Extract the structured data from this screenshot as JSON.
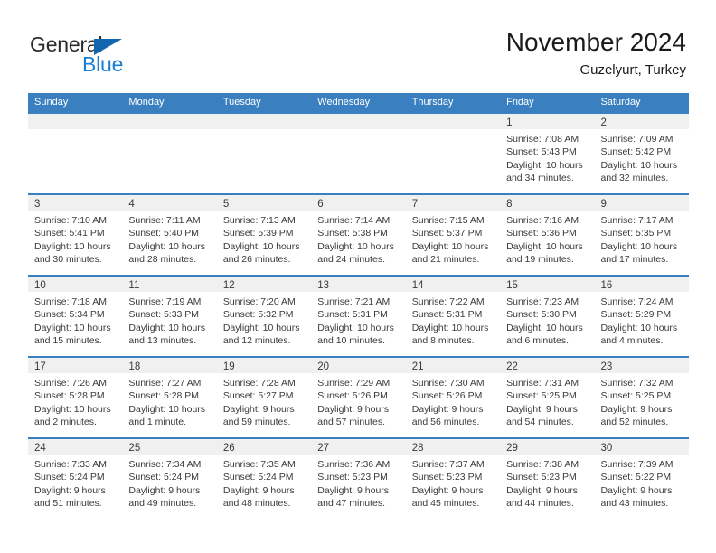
{
  "logo": {
    "word_dark": "General",
    "word_blue": "Blue",
    "triangle_color": "#1266b0",
    "blue_color": "#1a7fd4"
  },
  "header": {
    "title": "November 2024",
    "subtitle": "Guzelyurt, Turkey"
  },
  "theme": {
    "header_blue": "#3a7fc0",
    "daynum_band": "#f0f0f0",
    "text": "#3a3a3a"
  },
  "calendar": {
    "day_headers": [
      "Sunday",
      "Monday",
      "Tuesday",
      "Wednesday",
      "Thursday",
      "Friday",
      "Saturday"
    ],
    "weeks": [
      [
        {
          "day": "",
          "lines": []
        },
        {
          "day": "",
          "lines": []
        },
        {
          "day": "",
          "lines": []
        },
        {
          "day": "",
          "lines": []
        },
        {
          "day": "",
          "lines": []
        },
        {
          "day": "1",
          "lines": [
            "Sunrise: 7:08 AM",
            "Sunset: 5:43 PM",
            "Daylight: 10 hours",
            "and 34 minutes."
          ]
        },
        {
          "day": "2",
          "lines": [
            "Sunrise: 7:09 AM",
            "Sunset: 5:42 PM",
            "Daylight: 10 hours",
            "and 32 minutes."
          ]
        }
      ],
      [
        {
          "day": "3",
          "lines": [
            "Sunrise: 7:10 AM",
            "Sunset: 5:41 PM",
            "Daylight: 10 hours",
            "and 30 minutes."
          ]
        },
        {
          "day": "4",
          "lines": [
            "Sunrise: 7:11 AM",
            "Sunset: 5:40 PM",
            "Daylight: 10 hours",
            "and 28 minutes."
          ]
        },
        {
          "day": "5",
          "lines": [
            "Sunrise: 7:13 AM",
            "Sunset: 5:39 PM",
            "Daylight: 10 hours",
            "and 26 minutes."
          ]
        },
        {
          "day": "6",
          "lines": [
            "Sunrise: 7:14 AM",
            "Sunset: 5:38 PM",
            "Daylight: 10 hours",
            "and 24 minutes."
          ]
        },
        {
          "day": "7",
          "lines": [
            "Sunrise: 7:15 AM",
            "Sunset: 5:37 PM",
            "Daylight: 10 hours",
            "and 21 minutes."
          ]
        },
        {
          "day": "8",
          "lines": [
            "Sunrise: 7:16 AM",
            "Sunset: 5:36 PM",
            "Daylight: 10 hours",
            "and 19 minutes."
          ]
        },
        {
          "day": "9",
          "lines": [
            "Sunrise: 7:17 AM",
            "Sunset: 5:35 PM",
            "Daylight: 10 hours",
            "and 17 minutes."
          ]
        }
      ],
      [
        {
          "day": "10",
          "lines": [
            "Sunrise: 7:18 AM",
            "Sunset: 5:34 PM",
            "Daylight: 10 hours",
            "and 15 minutes."
          ]
        },
        {
          "day": "11",
          "lines": [
            "Sunrise: 7:19 AM",
            "Sunset: 5:33 PM",
            "Daylight: 10 hours",
            "and 13 minutes."
          ]
        },
        {
          "day": "12",
          "lines": [
            "Sunrise: 7:20 AM",
            "Sunset: 5:32 PM",
            "Daylight: 10 hours",
            "and 12 minutes."
          ]
        },
        {
          "day": "13",
          "lines": [
            "Sunrise: 7:21 AM",
            "Sunset: 5:31 PM",
            "Daylight: 10 hours",
            "and 10 minutes."
          ]
        },
        {
          "day": "14",
          "lines": [
            "Sunrise: 7:22 AM",
            "Sunset: 5:31 PM",
            "Daylight: 10 hours",
            "and 8 minutes."
          ]
        },
        {
          "day": "15",
          "lines": [
            "Sunrise: 7:23 AM",
            "Sunset: 5:30 PM",
            "Daylight: 10 hours",
            "and 6 minutes."
          ]
        },
        {
          "day": "16",
          "lines": [
            "Sunrise: 7:24 AM",
            "Sunset: 5:29 PM",
            "Daylight: 10 hours",
            "and 4 minutes."
          ]
        }
      ],
      [
        {
          "day": "17",
          "lines": [
            "Sunrise: 7:26 AM",
            "Sunset: 5:28 PM",
            "Daylight: 10 hours",
            "and 2 minutes."
          ]
        },
        {
          "day": "18",
          "lines": [
            "Sunrise: 7:27 AM",
            "Sunset: 5:28 PM",
            "Daylight: 10 hours",
            "and 1 minute."
          ]
        },
        {
          "day": "19",
          "lines": [
            "Sunrise: 7:28 AM",
            "Sunset: 5:27 PM",
            "Daylight: 9 hours",
            "and 59 minutes."
          ]
        },
        {
          "day": "20",
          "lines": [
            "Sunrise: 7:29 AM",
            "Sunset: 5:26 PM",
            "Daylight: 9 hours",
            "and 57 minutes."
          ]
        },
        {
          "day": "21",
          "lines": [
            "Sunrise: 7:30 AM",
            "Sunset: 5:26 PM",
            "Daylight: 9 hours",
            "and 56 minutes."
          ]
        },
        {
          "day": "22",
          "lines": [
            "Sunrise: 7:31 AM",
            "Sunset: 5:25 PM",
            "Daylight: 9 hours",
            "and 54 minutes."
          ]
        },
        {
          "day": "23",
          "lines": [
            "Sunrise: 7:32 AM",
            "Sunset: 5:25 PM",
            "Daylight: 9 hours",
            "and 52 minutes."
          ]
        }
      ],
      [
        {
          "day": "24",
          "lines": [
            "Sunrise: 7:33 AM",
            "Sunset: 5:24 PM",
            "Daylight: 9 hours",
            "and 51 minutes."
          ]
        },
        {
          "day": "25",
          "lines": [
            "Sunrise: 7:34 AM",
            "Sunset: 5:24 PM",
            "Daylight: 9 hours",
            "and 49 minutes."
          ]
        },
        {
          "day": "26",
          "lines": [
            "Sunrise: 7:35 AM",
            "Sunset: 5:24 PM",
            "Daylight: 9 hours",
            "and 48 minutes."
          ]
        },
        {
          "day": "27",
          "lines": [
            "Sunrise: 7:36 AM",
            "Sunset: 5:23 PM",
            "Daylight: 9 hours",
            "and 47 minutes."
          ]
        },
        {
          "day": "28",
          "lines": [
            "Sunrise: 7:37 AM",
            "Sunset: 5:23 PM",
            "Daylight: 9 hours",
            "and 45 minutes."
          ]
        },
        {
          "day": "29",
          "lines": [
            "Sunrise: 7:38 AM",
            "Sunset: 5:23 PM",
            "Daylight: 9 hours",
            "and 44 minutes."
          ]
        },
        {
          "day": "30",
          "lines": [
            "Sunrise: 7:39 AM",
            "Sunset: 5:22 PM",
            "Daylight: 9 hours",
            "and 43 minutes."
          ]
        }
      ]
    ]
  }
}
